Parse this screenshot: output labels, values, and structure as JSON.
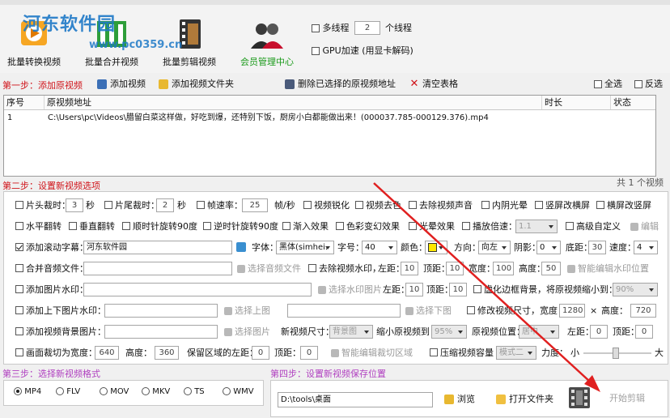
{
  "titlebar": {
    "text": ""
  },
  "watermark": {
    "name": "河东软件园",
    "url": "www.pc0359.cn"
  },
  "toolbar": {
    "batch_convert": "批量转换视频",
    "batch_merge": "批量合并视频",
    "batch_edit": "批量剪辑视频",
    "member_center": "会员管理中心",
    "multithread_label": "多线程",
    "thread_count": "2",
    "thread_unit": "个线程",
    "gpu_label": "GPU加速 (用显卡解码)"
  },
  "step1": {
    "title": "第一步：添加原视频",
    "add_video": "添加视频",
    "add_folder": "添加视频文件夹",
    "delete_selected": "删除已选择的原视频地址",
    "clear_table": "清空表格",
    "select_all": "全选",
    "invert": "反选"
  },
  "table": {
    "headers": {
      "index": "序号",
      "path": "原视频地址",
      "duration": "时长",
      "status": "状态"
    },
    "rows": [
      {
        "index": "1",
        "path": "C:\\Users\\pc\\Videos\\腊留白菜这样做，好吃到爆，还特别下饭，厨房小白都能做出来！(000037.785-000129.376).mp4",
        "duration": "",
        "status": ""
      }
    ],
    "total": "共 1 个视频"
  },
  "step2": {
    "title": "第二步：设置新视频选项",
    "head_trim": "片头裁时：",
    "head_val": "3",
    "sec1": "秒",
    "tail_trim": "片尾裁时：",
    "tail_val": "2",
    "sec2": "秒",
    "fps": "帧速率：",
    "fps_val": "25",
    "fps_unit": "帧/秒",
    "sharpen": "视频锐化",
    "decolor": "视频去色",
    "remove_audio": "去除视频声音",
    "inner_glow": "内阴光晕",
    "portrait_to_landscape": "竖屏改横屏",
    "landscape_to_portrait": "横屏改竖屏",
    "hflip": "水平翻转",
    "vflip": "垂直翻转",
    "rotate_cw": "顺时针旋转90度",
    "rotate_ccw": "逆时针旋转90度",
    "fade_in": "渐入效果",
    "color_change": "色彩变幻效果",
    "light_effect": "光晕效果",
    "speed": "播放倍速：",
    "speed_val": "1.1",
    "advanced_custom": "高级自定义",
    "edit": "编辑",
    "scroll_caption": "添加滚动字幕：",
    "caption_text": "河东软件园",
    "font": "字体：",
    "font_val": "黑体(simhei.",
    "font_size": "字号：",
    "font_size_val": "40",
    "color": "颜色：",
    "direction": "方向：",
    "direction_val": "向左",
    "shadow": "阴影：",
    "shadow_val": "0",
    "bottom": "底距：",
    "bottom_val": "30",
    "speed2": "速度：",
    "speed2_val": "4",
    "merge_audio": "合并音频文件：",
    "choose_audio": "选择音频文件",
    "remove_watermark": "去除视频水印，",
    "left": "左距：",
    "wm_left": "10",
    "top": "顶距：",
    "wm_top": "10",
    "width": "宽度：",
    "wm_width": "100",
    "height": "高度：",
    "wm_height": "50",
    "smart_wm": "智能编辑水印位置",
    "add_image_wm": "添加图片水印：",
    "choose_wm_image": "选择水印图片",
    "img_left": "10",
    "img_top": "10",
    "blur_border": "虚化边框背景，将原视频缩小到：",
    "blur_val": "90%",
    "add_top_bottom_wm": "添加上下图片水印：",
    "choose_top": "选择上图",
    "choose_bottom": "选择下图",
    "resize": "修改视频尺寸，宽度：",
    "resize_w": "1280",
    "times": "×",
    "resize_h_label": "高度：",
    "resize_h": "720",
    "add_bg_image": "添加视频背景图片：",
    "choose_image": "选择图片",
    "new_size": "新视频尺寸：",
    "new_size_val": "背景图",
    "shrink_to": "缩小原视频到：",
    "shrink_val": "95%",
    "orig_pos": "原视频位置：",
    "orig_pos_val": "居中",
    "bg_left": "0",
    "bg_top": "0",
    "crop": "画面裁切为宽度：",
    "crop_w": "640",
    "crop_h_label": "高度：",
    "crop_h": "360",
    "keep_left": "保留区域的左距：",
    "keep_left_val": "0",
    "keep_top_label": "顶距：",
    "keep_top_val": "0",
    "smart_crop": "智能编辑裁切区域",
    "compress": "压缩视频容量",
    "compress_mode": "模式二",
    "strength": "力度：",
    "small": "小",
    "large": "大"
  },
  "step3": {
    "title": "第三步：选择新视频格式",
    "formats": [
      "MP4",
      "FLV",
      "MOV",
      "MKV",
      "TS",
      "WMV"
    ],
    "selected": "MP4"
  },
  "step4": {
    "title": "第四步：设置新视频保存位置",
    "path": "D:\\tools\\桌面",
    "browse": "浏览",
    "open_folder": "打开文件夹",
    "start": "开始剪辑"
  },
  "colors": {
    "step_red": "#d0141a",
    "step_purple": "#b040c0",
    "accent_blue": "#1e79c7"
  }
}
